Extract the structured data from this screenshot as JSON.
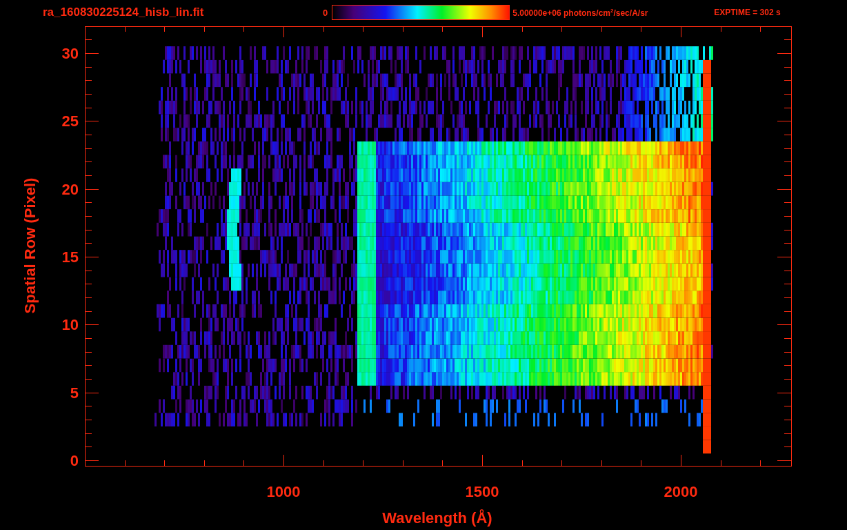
{
  "header": {
    "file_name": "ra_160830225124_hisb_lin.fit",
    "colorbar": {
      "min_label": "0",
      "max_label": "5.00000e+06 photons/cm$^{2}$/sec/A/sr"
    },
    "exposure": "EXPTIME = 302 s"
  },
  "plot": {
    "y_axis": {
      "label": "Spatial Row (Pixel)",
      "ticks": [
        "30",
        "25",
        "20",
        "15",
        "10",
        "5",
        "0"
      ]
    },
    "x_axis": {
      "label": "Wavelength (Å)",
      "ticks": [
        "1000",
        "1500",
        "2000"
      ]
    }
  }
}
